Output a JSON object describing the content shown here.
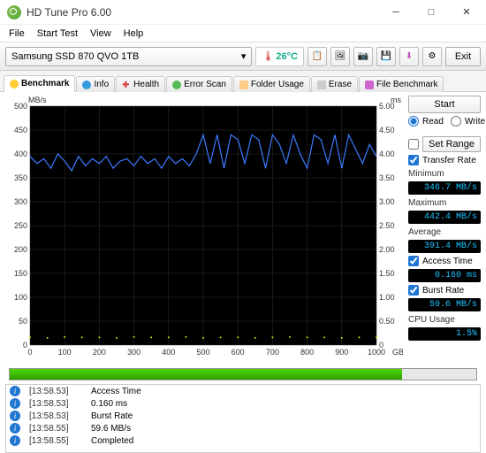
{
  "title": "HD Tune Pro 6.00",
  "menu": [
    "File",
    "Start Test",
    "View",
    "Help"
  ],
  "drive": "Samsung SSD 870 QVO 1TB",
  "temperature": "26°C",
  "exit": "Exit",
  "tabs": [
    {
      "label": "Benchmark"
    },
    {
      "label": "Info"
    },
    {
      "label": "Health"
    },
    {
      "label": "Error Scan"
    },
    {
      "label": "Folder Usage"
    },
    {
      "label": "Erase"
    },
    {
      "label": "File Benchmark"
    }
  ],
  "y_unit": "MB/s",
  "x_unit": "GB",
  "y2_unit": "ms",
  "y_ticks": [
    "500",
    "450",
    "400",
    "350",
    "300",
    "250",
    "200",
    "150",
    "100",
    "50",
    "0"
  ],
  "y2_ticks": [
    "5.00",
    "4.50",
    "4.00",
    "3.50",
    "3.00",
    "2.50",
    "2.00",
    "1.50",
    "1.00",
    "0.50",
    "0"
  ],
  "x_ticks": [
    "0",
    "100",
    "200",
    "300",
    "400",
    "500",
    "600",
    "700",
    "800",
    "900",
    "1000"
  ],
  "controls": {
    "start": "Start",
    "read": "Read",
    "write": "Write",
    "setrange": "Set Range",
    "transferrate": "Transfer Rate",
    "minimum": "Minimum",
    "min_val": "346.7 MB/s",
    "maximum": "Maximum",
    "max_val": "442.4 MB/s",
    "average": "Average",
    "avg_val": "391.4 MB/s",
    "accesstime": "Access Time",
    "at_val": "0.160 ms",
    "burstrate": "Burst Rate",
    "br_val": "59.6 MB/s",
    "cpuusage": "CPU Usage",
    "cpu_val": "1.5%"
  },
  "log": [
    {
      "t": "[13:58.53]",
      "m": "Access Time"
    },
    {
      "t": "[13:58.53]",
      "m": "0.160 ms"
    },
    {
      "t": "[13:58.53]",
      "m": "Burst Rate"
    },
    {
      "t": "[13:58.55]",
      "m": "59.6 MB/s"
    },
    {
      "t": "[13:58.55]",
      "m": "Completed"
    }
  ],
  "chart_data": {
    "type": "line",
    "title": "",
    "xlabel": "GB",
    "ylabel": "MB/s",
    "y2label": "ms",
    "xlim": [
      0,
      1000
    ],
    "ylim": [
      0,
      500
    ],
    "y2lim": [
      0,
      5.0
    ],
    "series": [
      {
        "name": "Transfer Rate",
        "axis": "y",
        "color": "#3b7bff",
        "x": [
          0,
          20,
          40,
          60,
          80,
          100,
          120,
          140,
          160,
          180,
          200,
          220,
          240,
          260,
          280,
          300,
          320,
          340,
          360,
          380,
          400,
          420,
          440,
          460,
          480,
          500,
          520,
          540,
          560,
          580,
          600,
          620,
          640,
          660,
          680,
          700,
          720,
          740,
          760,
          780,
          800,
          820,
          840,
          860,
          880,
          900,
          920,
          940,
          960,
          980,
          1000
        ],
        "y": [
          395,
          380,
          390,
          370,
          400,
          385,
          365,
          395,
          375,
          390,
          380,
          395,
          370,
          385,
          390,
          375,
          395,
          380,
          390,
          370,
          395,
          380,
          390,
          375,
          400,
          440,
          380,
          440,
          370,
          440,
          430,
          380,
          440,
          430,
          370,
          440,
          420,
          380,
          440,
          400,
          370,
          440,
          430,
          380,
          440,
          370,
          440,
          410,
          380,
          420,
          395
        ]
      },
      {
        "name": "Access Time",
        "axis": "y2",
        "color": "#e0d800",
        "x": [
          0,
          50,
          100,
          150,
          200,
          250,
          300,
          350,
          400,
          450,
          500,
          550,
          600,
          650,
          700,
          750,
          800,
          850,
          900,
          950,
          1000
        ],
        "y": [
          0.16,
          0.15,
          0.17,
          0.16,
          0.16,
          0.15,
          0.17,
          0.16,
          0.16,
          0.17,
          0.15,
          0.16,
          0.16,
          0.15,
          0.16,
          0.17,
          0.16,
          0.16,
          0.15,
          0.16,
          0.16
        ]
      }
    ]
  }
}
